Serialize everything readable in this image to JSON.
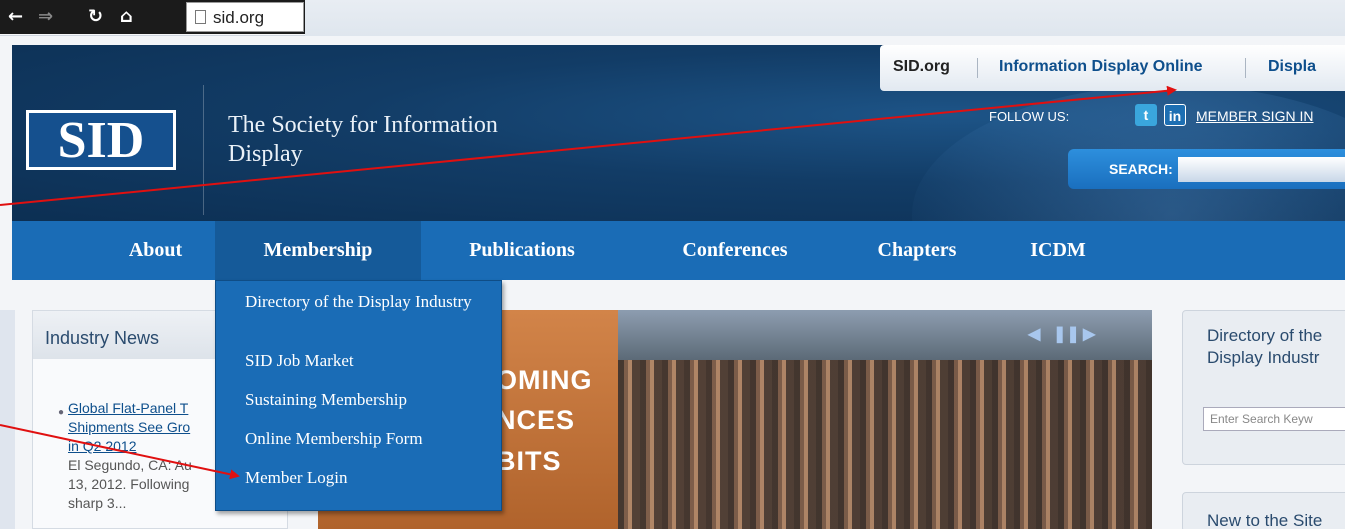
{
  "browser": {
    "address": "sid.org",
    "icons": [
      "back-icon",
      "forward-icon",
      "reload-icon",
      "home-icon",
      "page-icon"
    ]
  },
  "topnav": {
    "items": [
      "SID.org",
      "Information Display Online",
      "Displa"
    ]
  },
  "header": {
    "logo": "SID",
    "org_name": "The Society for Information Display",
    "follow_label": "FOLLOW US:",
    "twitter_glyph": "t",
    "linkedin_glyph": "in",
    "signin": "MEMBER SIGN IN",
    "search_label": "SEARCH:"
  },
  "mainnav": {
    "items": [
      "About",
      "Membership",
      "Publications",
      "Conferences",
      "Chapters",
      "ICDM"
    ]
  },
  "dropdown": {
    "items": [
      "Directory of the Display Industry",
      "SID Job Market",
      "Sustaining Membership",
      "Online Membership Form",
      "Member Login"
    ]
  },
  "news": {
    "title": "Industry News",
    "link": "Global Flat-Panel T… Shipments See Gro… in Q2 2012",
    "link_lines": [
      "Global Flat-Panel T",
      "Shipments See Gro",
      "in Q2 2012"
    ],
    "body_lines": [
      "El Segundo, CA: Au",
      "13, 2012. Following",
      "sharp 3..."
    ]
  },
  "hero": {
    "lines": [
      "OMING",
      "NCES",
      "BITS"
    ],
    "controls": [
      "◀",
      "❚❚",
      "▶"
    ]
  },
  "right_panel": {
    "title_lines": [
      "Directory of the",
      "Display Industr"
    ],
    "search_placeholder": "Enter Search Keyw",
    "second_title": "New to the Site"
  },
  "colors": {
    "nav_blue": "#1a6cb6",
    "header_dark": "#0c2f53",
    "annotation_red": "#e01010"
  }
}
